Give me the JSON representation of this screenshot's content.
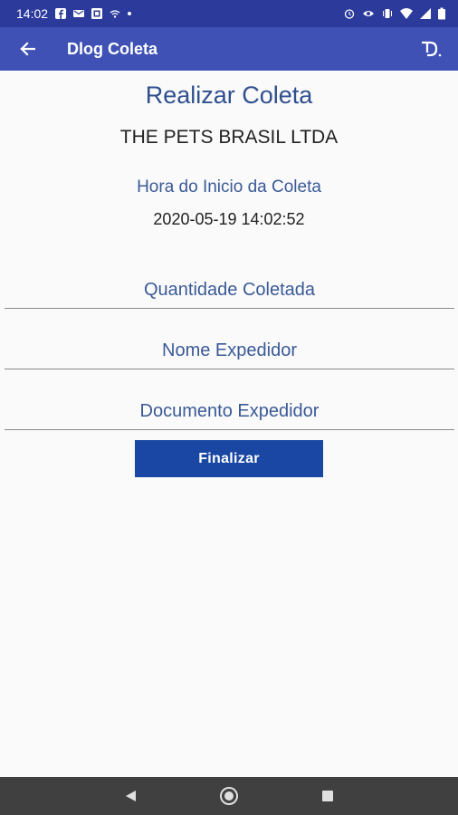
{
  "status_bar": {
    "time": "14:02",
    "left_icons": [
      "facebook-icon",
      "mail-icon",
      "photo-icon",
      "wifi-settings-icon",
      "dot-icon"
    ],
    "right_icons": [
      "alarm-icon",
      "eye-icon",
      "vibrate-icon",
      "wifi-icon",
      "signal-icon",
      "battery-icon"
    ]
  },
  "app_bar": {
    "title": "Dlog Coleta",
    "back_icon": "arrow-left-icon",
    "logo": "dlog-logo"
  },
  "main": {
    "page_title": "Realizar Coleta",
    "company": "THE PETS BRASIL LTDA",
    "start_label": "Hora do Inicio da Coleta",
    "start_value": "2020-05-19 14:02:52",
    "quantity_placeholder": "Quantidade Coletada",
    "name_placeholder": "Nome Expedidor",
    "document_placeholder": "Documento Expedidor",
    "finish_label": "Finalizar"
  },
  "nav_bar": {
    "buttons": [
      "back-triangle-icon",
      "home-circle-icon",
      "recents-square-icon"
    ]
  },
  "colors": {
    "status_bar": "#2c3a9c",
    "app_bar": "#3f51b5",
    "accent_text": "#3a5a97",
    "button": "#1a47a3",
    "nav_bar": "#404040"
  }
}
